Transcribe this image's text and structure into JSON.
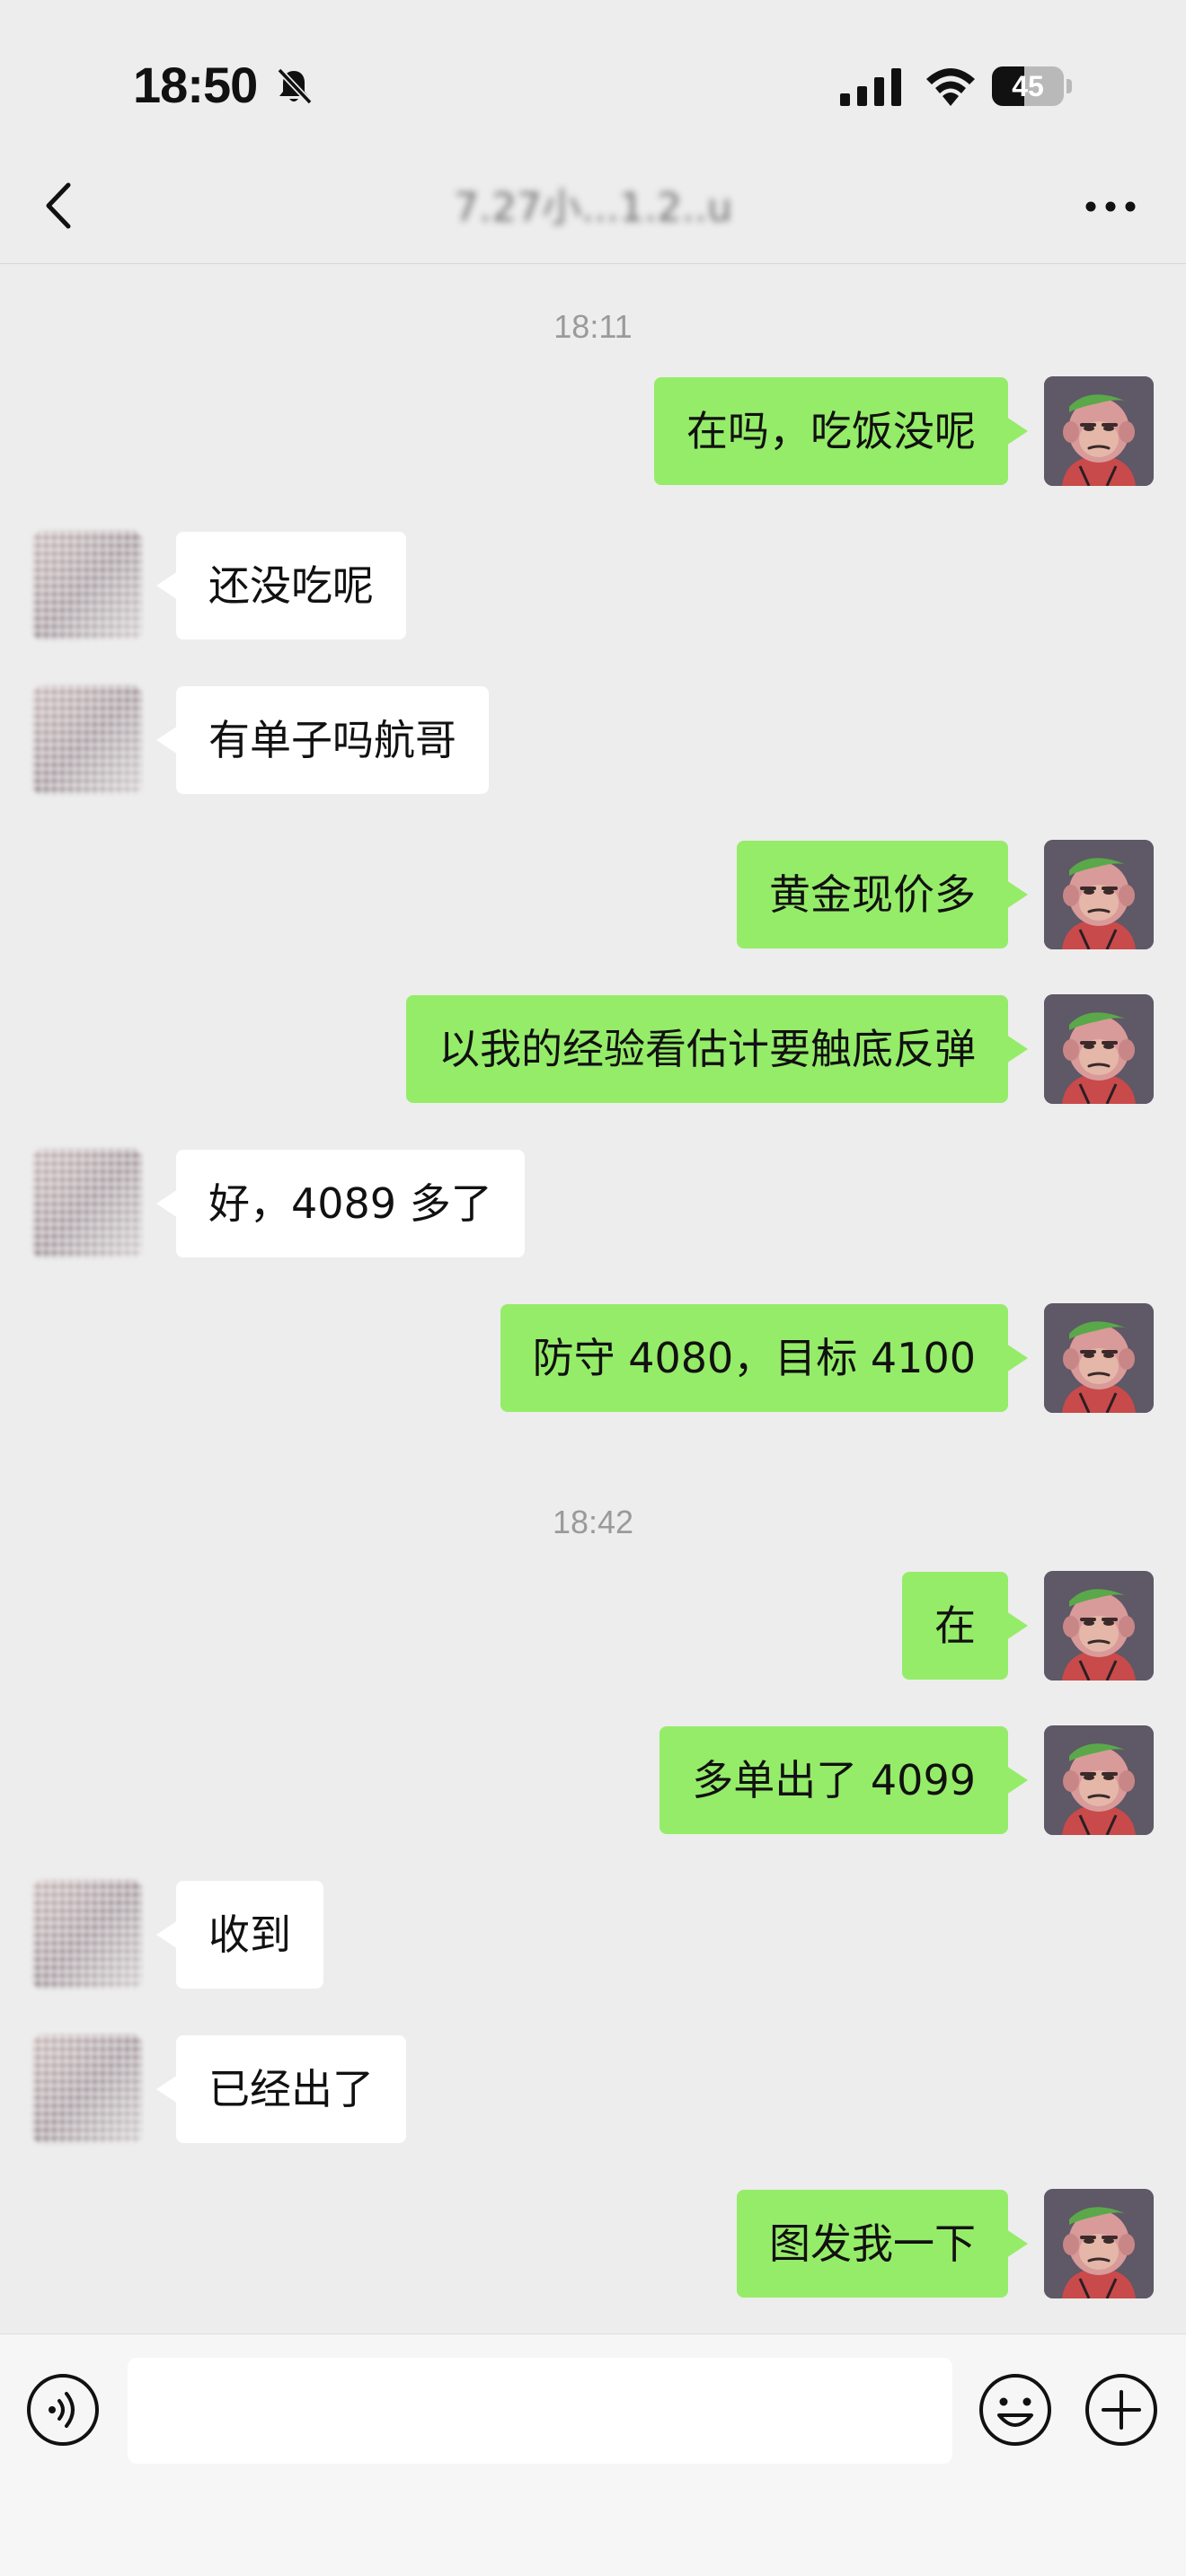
{
  "status_bar": {
    "time": "18:50",
    "battery_level": "45",
    "battery_fraction": 0.45,
    "icons": [
      "bell-off-icon",
      "cellular-signal-icon",
      "wifi-icon",
      "battery-icon"
    ]
  },
  "nav": {
    "title": "7.27小...1.2..u",
    "back_icon": "chevron-left-icon",
    "more_icon": "ellipsis-icon"
  },
  "messages": [
    {
      "type": "time",
      "text": "18:11"
    },
    {
      "type": "msg",
      "from": "me",
      "text": "在吗，吃饭没呢"
    },
    {
      "type": "msg",
      "from": "them",
      "text": "还没吃呢"
    },
    {
      "type": "msg",
      "from": "them",
      "text": "有单子吗航哥"
    },
    {
      "type": "msg",
      "from": "me",
      "text": "黄金现价多"
    },
    {
      "type": "msg",
      "from": "me",
      "text": "以我的经验看估计要触底反弹"
    },
    {
      "type": "msg",
      "from": "them",
      "text": "好，4089 多了"
    },
    {
      "type": "msg",
      "from": "me",
      "text": "防守 4080，目标 4100"
    },
    {
      "type": "time",
      "text": "18:42"
    },
    {
      "type": "msg",
      "from": "me",
      "text": "在"
    },
    {
      "type": "msg",
      "from": "me",
      "text": "多单出了 4099"
    },
    {
      "type": "msg",
      "from": "them",
      "text": "收到"
    },
    {
      "type": "msg",
      "from": "them",
      "text": "已经出了"
    },
    {
      "type": "msg",
      "from": "me",
      "text": "图发我一下"
    }
  ],
  "input_bar": {
    "placeholder": "",
    "voice_icon": "voice-icon",
    "emoji_icon": "emoji-icon",
    "plus_icon": "plus-icon"
  },
  "colors": {
    "background": "#ededed",
    "my_bubble": "#95ec69",
    "their_bubble": "#ffffff",
    "my_avatar_bg": "#5f5866"
  }
}
